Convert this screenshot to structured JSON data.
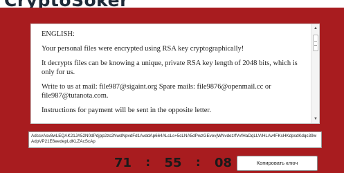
{
  "header": {
    "title": "CryptoSoker"
  },
  "message": {
    "paragraphs": [
      "ENGLISH:",
      "Your personal files were encrypted using RSA key cryptographically!",
      "It decrypts files can be knowing a unique, private RSA key length of 2048 bits, which is only for us.",
      "Write to us at mail: file987@sigaint.org Spare mails: file9876@openmail.cc or file987@tutanota.com.",
      "Instructions for payment will be sent in the opposite letter."
    ]
  },
  "key": {
    "text": "AdccvAsv8wLEQAK21JA52N0dPdjpp2zc2NwdNpvdFd1AvddAp664ALcLs+5cLNA5dPwzGEvevjWNvdez/fVvfHaDqLLV/HLAv4FKsHKdpsdKdqc39wAdpVP21E6eedepLdKLZAcScAp"
  },
  "timer": {
    "hours": "71",
    "minutes": "55",
    "seconds": "08",
    "separator": ":"
  },
  "copy_button": {
    "label": "Копировать ключ"
  },
  "colors": {
    "window_background": "#a81c1f",
    "text_box_background": "#ffffff"
  },
  "icons": {
    "scroll_up": "chevron-up-icon",
    "scroll_down": "chevron-down-icon"
  }
}
